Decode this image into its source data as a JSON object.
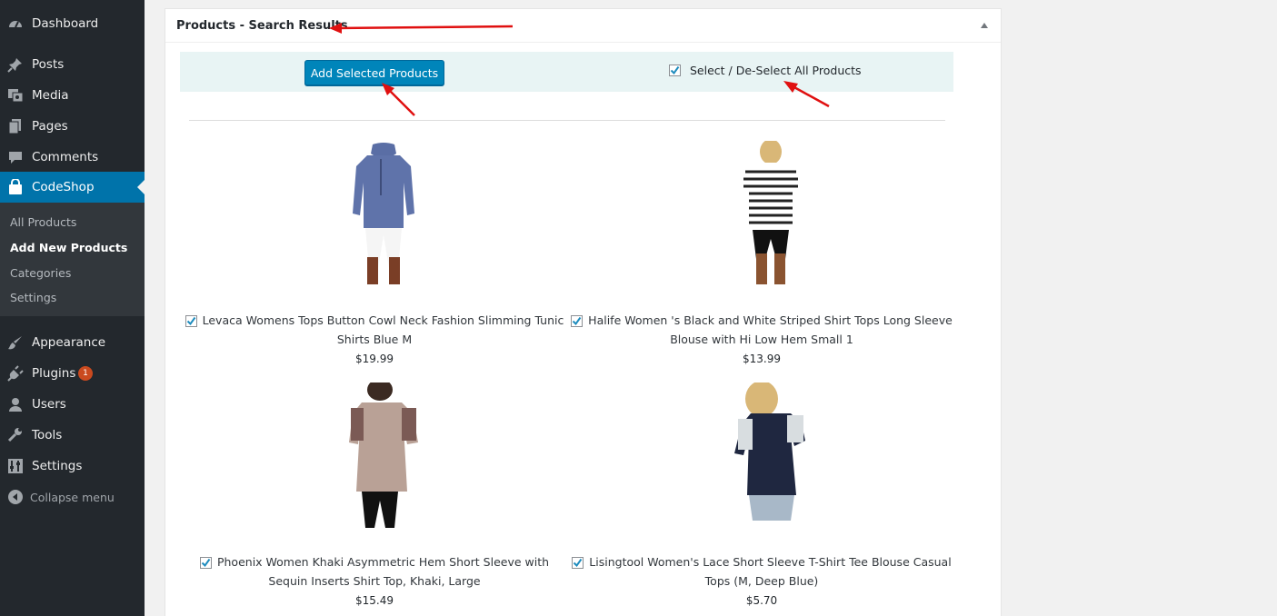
{
  "sidebar": {
    "items": [
      {
        "label": "Dashboard",
        "icon": "dashboard-icon"
      },
      {
        "label": "Posts",
        "icon": "pin-icon"
      },
      {
        "label": "Media",
        "icon": "media-icon"
      },
      {
        "label": "Pages",
        "icon": "pages-icon"
      },
      {
        "label": "Comments",
        "icon": "comments-icon"
      },
      {
        "label": "CodeShop",
        "icon": "shopping-bag-icon"
      },
      {
        "label": "Appearance",
        "icon": "paintbrush-icon"
      },
      {
        "label": "Plugins",
        "icon": "plugin-icon",
        "badge": "1"
      },
      {
        "label": "Users",
        "icon": "users-icon"
      },
      {
        "label": "Tools",
        "icon": "wrench-icon"
      },
      {
        "label": "Settings",
        "icon": "settings-icon"
      }
    ],
    "submenu": [
      "All Products",
      "Add New Products",
      "Categories",
      "Settings"
    ],
    "collapse_label": "Collapse menu"
  },
  "panel": {
    "title": "Products - Search Results",
    "add_button_label": "Add Selected Products",
    "select_all_label": "Select / De-Select All Products"
  },
  "products": [
    {
      "title": "Levaca Womens Tops Button Cowl Neck Fashion Slimming Tunic Shirts Blue M",
      "price": "$19.99",
      "checked": true
    },
    {
      "title": "Halife Women 's Black and White Striped Shirt Tops Long Sleeve Blouse with Hi Low Hem Small 1",
      "price": "$13.99",
      "checked": true
    },
    {
      "title": "Phoenix Women Khaki Asymmetric Hem Short Sleeve with Sequin Inserts Shirt Top, Khaki, Large",
      "price": "$15.49",
      "checked": true
    },
    {
      "title": "Lisingtool Women's Lace Short Sleeve T-Shirt Tee Blouse Casual Tops (M, Deep Blue)",
      "price": "$5.70",
      "checked": true
    }
  ],
  "colors": {
    "sidebar_bg": "#23282d",
    "submenu_bg": "#32373c",
    "active_bg": "#0073aa",
    "button_bg": "#0085ba",
    "actions_bar_bg": "#e8f4f4",
    "badge_bg": "#ca4a1f",
    "annotation_arrow": "#e01010"
  }
}
